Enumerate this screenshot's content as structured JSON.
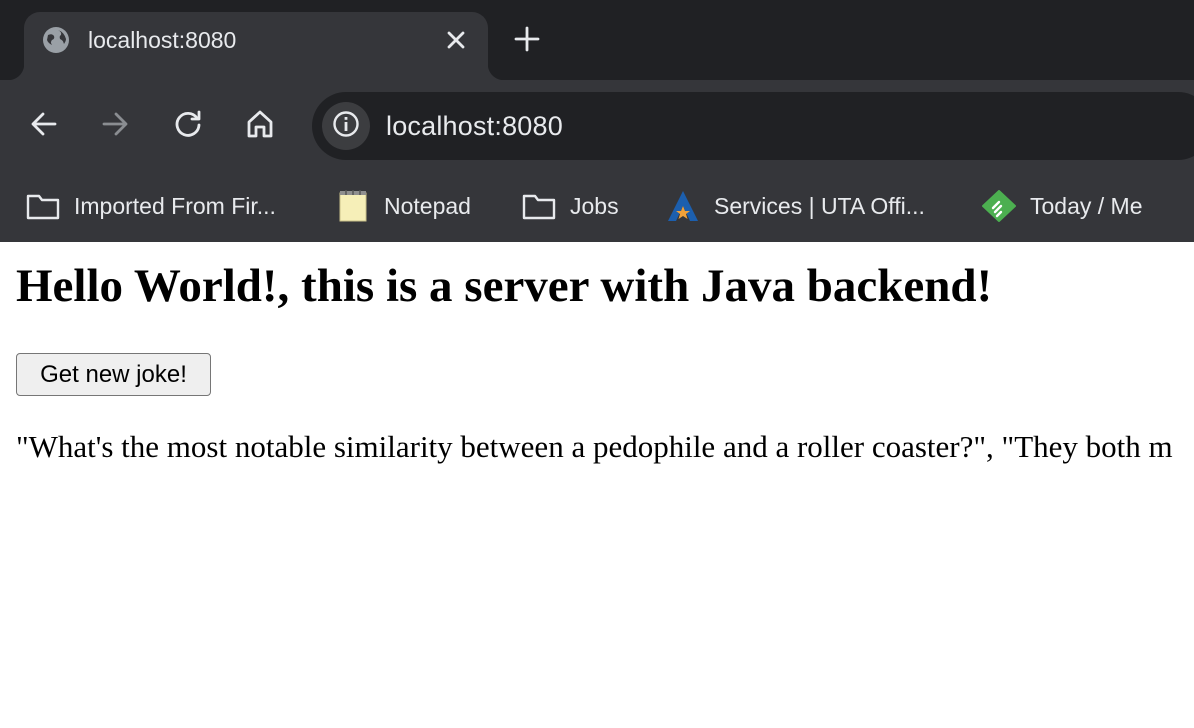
{
  "browser": {
    "tab": {
      "title": "localhost:8080",
      "favicon": "globe-icon",
      "close_icon": "close-icon"
    },
    "new_tab_icon": "plus-icon",
    "nav": {
      "back_icon": "back-arrow-icon",
      "forward_icon": "forward-arrow-icon",
      "reload_icon": "reload-icon",
      "home_icon": "home-icon"
    },
    "omnibox": {
      "info_icon": "info-icon",
      "url": "localhost:8080"
    },
    "bookmarks": [
      {
        "label": "Imported From Fir...",
        "icon": "folder-icon"
      },
      {
        "label": "Notepad",
        "icon": "notepad-icon"
      },
      {
        "label": "Jobs",
        "icon": "folder-icon"
      },
      {
        "label": "Services | UTA Offi...",
        "icon": "uta-logo-icon"
      },
      {
        "label": "Today / Me",
        "icon": "feedly-icon"
      }
    ],
    "colors": {
      "tabstrip": "#202124",
      "toolbar": "#35363a",
      "text": "#e8eaed"
    }
  },
  "page": {
    "heading": "Hello World!, this is a server with Java backend!",
    "button_label": "Get new joke!",
    "joke_text": "\"What's the most notable similarity between a pedophile and a roller coaster?\", \"They both m"
  }
}
